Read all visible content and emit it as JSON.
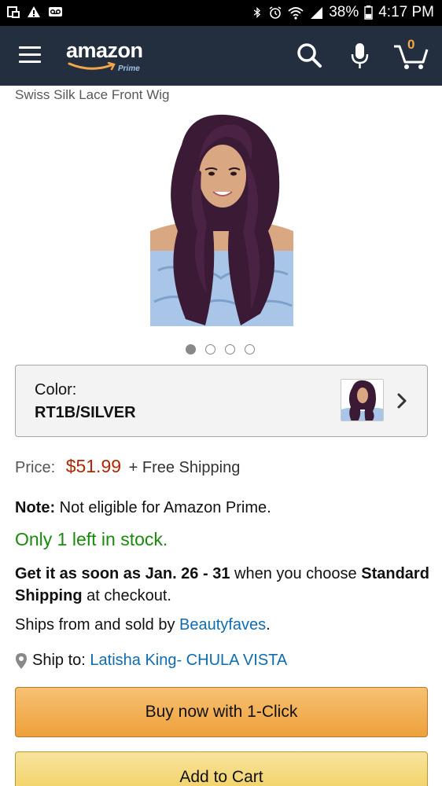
{
  "status_bar": {
    "battery": "38%",
    "time": "4:17 PM"
  },
  "header": {
    "logo_text": "amazon",
    "logo_sub": "Prime",
    "cart_count": "0"
  },
  "product": {
    "title": "Swiss Silk Lace Front Wig",
    "image_dots": 4,
    "active_dot": 0,
    "color_label": "Color:",
    "color_value": "RT1B/SILVER",
    "price_label": "Price:",
    "price": "$51.99",
    "shipping": "+ Free Shipping",
    "note_label": "Note:",
    "note_text": "Not eligible for Amazon Prime.",
    "stock": "Only 1 left in stock.",
    "delivery_prefix": "Get it as soon as Jan. 26 - 31",
    "delivery_middle": " when you choose ",
    "delivery_shipping": "Standard Shipping",
    "delivery_suffix": " at checkout.",
    "ships_from_prefix": "Ships from and sold by ",
    "seller": "Beautyfaves",
    "ships_from_suffix": ".",
    "ship_to_label": "Ship to:",
    "ship_to_value": "Latisha King- CHULA VISTA"
  },
  "buttons": {
    "buy_now": "Buy now with 1-Click",
    "add_to_cart": "Add to Cart"
  },
  "colors": {
    "header_bg": "#232f3e",
    "price": "#b12704",
    "stock": "#1a8a0d",
    "link": "#0f6cb0",
    "buy_now": "#eea03a",
    "add_to_cart": "#f1cf5c"
  }
}
